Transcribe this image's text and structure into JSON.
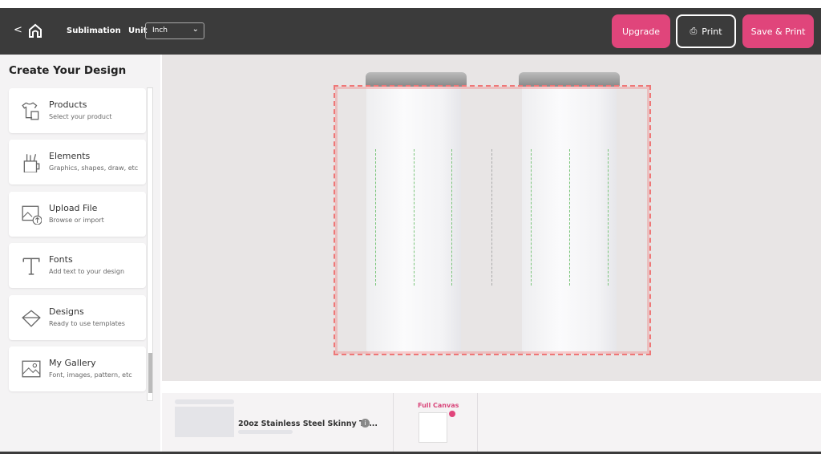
{
  "header": {
    "back": "<",
    "brand": "Sublimation",
    "unit_label": "Unit",
    "unit_value": "Inch",
    "upgrade": "Upgrade",
    "print": "Print",
    "save_print": "Save & Print"
  },
  "sidebar": {
    "title": "Create Your Design",
    "items": [
      {
        "label": "Products",
        "sub": "Select your product",
        "icon": "shirt-mug-icon"
      },
      {
        "label": "Elements",
        "sub": "Graphics, shapes, draw, etc",
        "icon": "pencil-cup-icon"
      },
      {
        "label": "Upload File",
        "sub": "Browse or import",
        "icon": "upload-image-icon"
      },
      {
        "label": "Fonts",
        "sub": "Add text to your design",
        "icon": "font-t-icon"
      },
      {
        "label": "Designs",
        "sub": "Ready to use templates",
        "icon": "template-icon"
      },
      {
        "label": "My Gallery",
        "sub": "Font, images, pattern, etc",
        "icon": "gallery-icon"
      }
    ]
  },
  "bottom": {
    "product_name": "20oz Stainless Steel Skinny Tu...",
    "view_label": "Full Canvas"
  },
  "colors": {
    "accent": "#e0457b",
    "header": "#3b3b3b"
  }
}
